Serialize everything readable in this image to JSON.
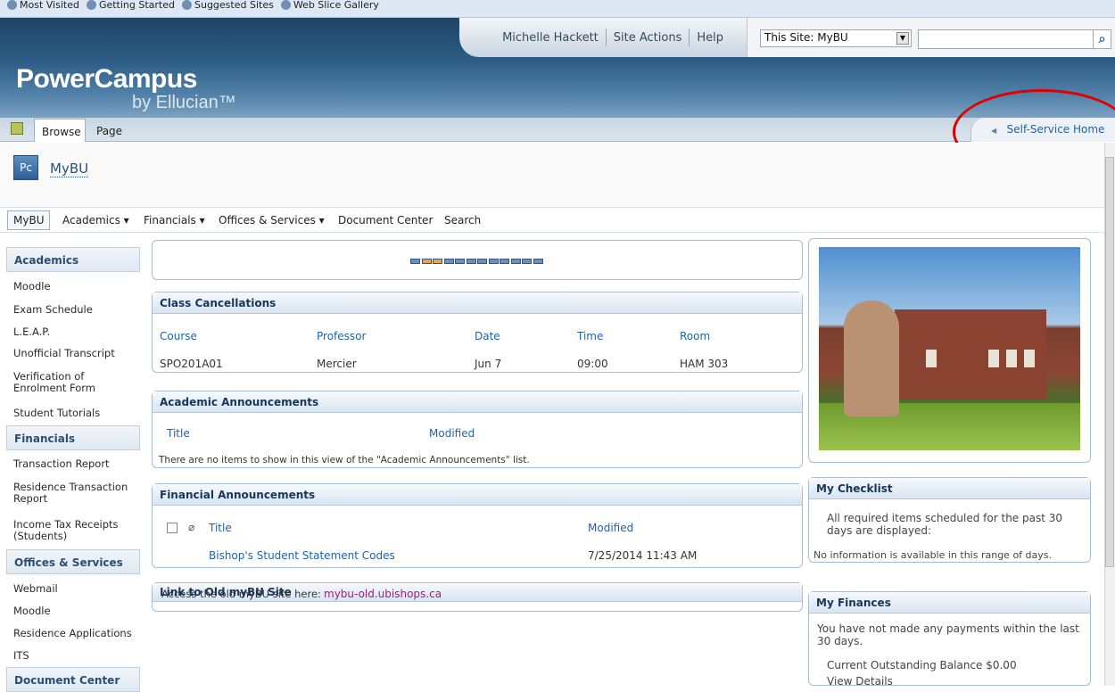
{
  "browser": {
    "favorites": [
      "Most Visited",
      "Getting Started",
      "Suggested Sites",
      "Web Slice Gallery"
    ]
  },
  "header": {
    "user": "Michelle Hackett",
    "site_actions": "Site Actions",
    "help": "Help",
    "search_scope": "This Site: MyBU",
    "search_value": "",
    "logo_main": "PowerCampus",
    "logo_sub": "by Ellucian™"
  },
  "ribbon": {
    "tabs": [
      "Browse",
      "Page"
    ],
    "self_service": "Self-Service Home"
  },
  "site": {
    "icon_text": "Pc",
    "title": "MyBU"
  },
  "global_nav": [
    "MyBU",
    "Academics ▾",
    "Financials ▾",
    "Offices & Services ▾",
    "Document Center",
    "Search"
  ],
  "left_nav": {
    "academics_header": "Academics",
    "academics": [
      "Moodle",
      "Exam Schedule",
      "L.E.A.P.",
      "Unofficial Transcript",
      "Verification of Enrolment Form",
      "Student Tutorials"
    ],
    "financials_header": "Financials",
    "financials": [
      "Transaction Report",
      "Residence Transaction Report",
      "Income Tax Receipts (Students)"
    ],
    "offices_header": "Offices & Services",
    "offices": [
      "Webmail",
      "Moodle",
      "Residence Applications",
      "ITS"
    ],
    "document_header": "Document Center"
  },
  "class_cancellations": {
    "title": "Class Cancellations",
    "columns": [
      "Course",
      "Professor",
      "Date",
      "Time",
      "Room"
    ],
    "rows": [
      [
        "SPO201A01",
        "Mercier",
        "Jun 7",
        "09:00",
        "HAM 303"
      ]
    ]
  },
  "academic_announcements": {
    "title": "Academic Announcements",
    "columns": [
      "Title",
      "Modified"
    ],
    "empty": "There are no items to show in this view of the \"Academic Announcements\" list."
  },
  "financial_announcements": {
    "title": "Financial Announcements",
    "columns": [
      "Title",
      "Modified"
    ],
    "item_title": "Bishop's Student Statement Codes",
    "item_modified": "7/25/2014 11:43 AM"
  },
  "old_site": {
    "title": "Link to Old myBU Site",
    "text": "Access the old myBU site here:",
    "link": "mybu-old.ubishops.ca"
  },
  "checklist": {
    "title": "My Checklist",
    "note": "All required items scheduled for the past 30 days are displayed:",
    "empty": "No information is available in this range of days."
  },
  "finances": {
    "title": "My Finances",
    "note": "You have not made any payments within the last 30 days.",
    "balance": "Current Outstanding Balance $0.00",
    "details": "View Details"
  }
}
